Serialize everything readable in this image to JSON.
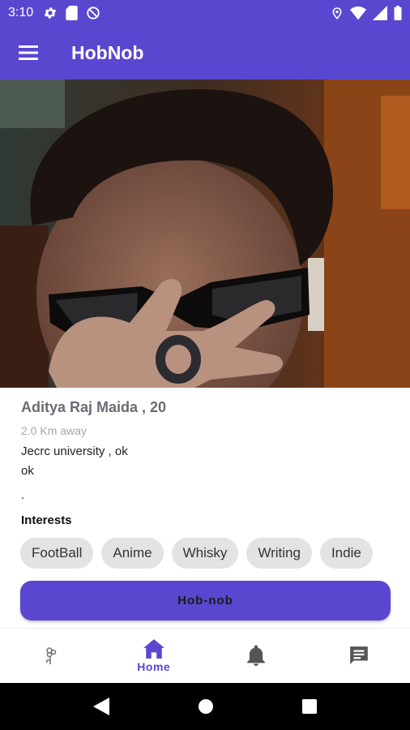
{
  "status_bar": {
    "time": "3:10"
  },
  "app_bar": {
    "title": "HobNob",
    "menu_icon": "hamburger-menu-icon"
  },
  "profile": {
    "name": "Aditya Raj Maida , 20",
    "distance": "2.0 Km away",
    "bio_line1": "Jecrc university , ok",
    "bio_line2": "ok",
    "bio_line3": ".",
    "interests_title": "Interests",
    "interests": [
      "FootBall",
      "Anime",
      "Whisky",
      "Writing",
      "Indie"
    ]
  },
  "action_button": {
    "label": "Hob-nob"
  },
  "bottom_nav": {
    "items": [
      {
        "icon": "flower-icon",
        "label": ""
      },
      {
        "icon": "home-icon",
        "label": "Home"
      },
      {
        "icon": "bell-icon",
        "label": ""
      },
      {
        "icon": "chat-icon",
        "label": ""
      }
    ]
  },
  "colors": {
    "primary": "#5a47cf",
    "chip_bg": "#e3e3e3"
  }
}
